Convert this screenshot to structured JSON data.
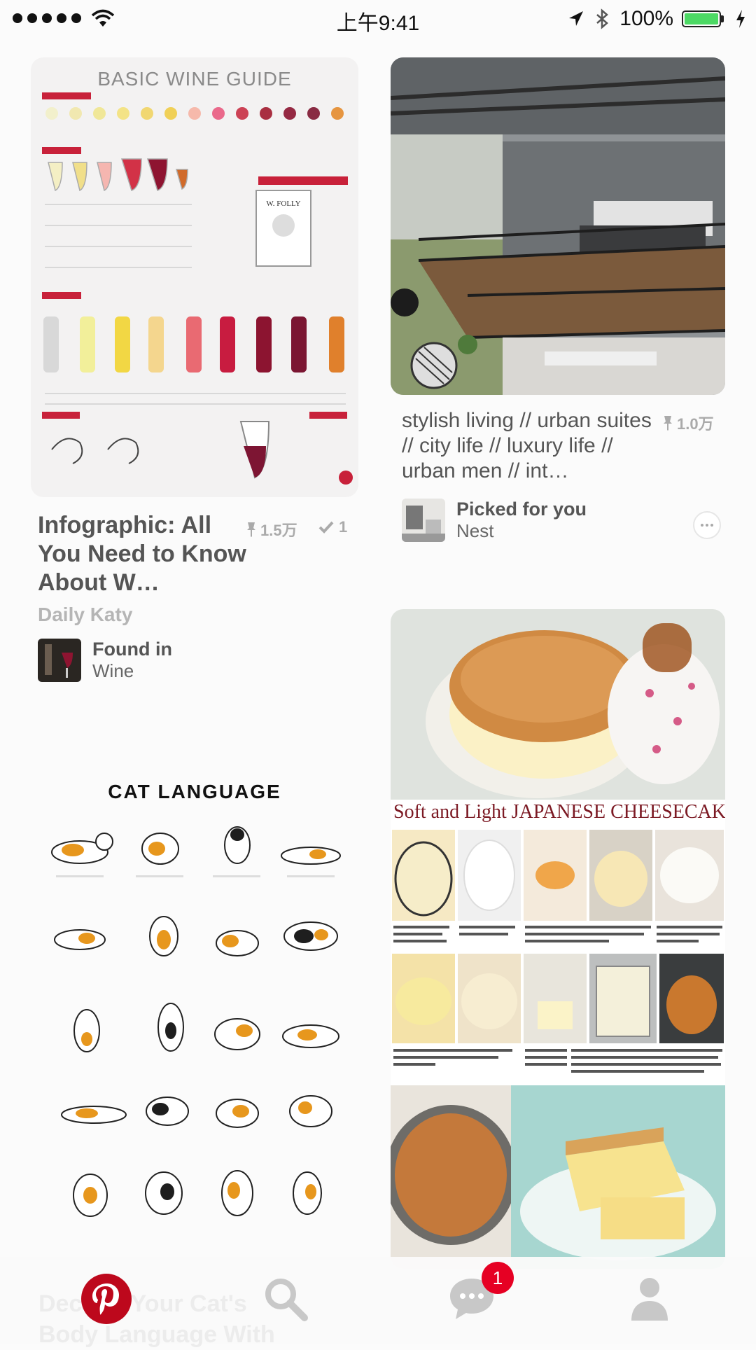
{
  "status_bar": {
    "time": "上午9:41",
    "battery_percent": "100%",
    "signal_icon": "signal-dots-icon",
    "wifi_icon": "wifi-icon",
    "location_icon": "location-arrow-icon",
    "bluetooth_icon": "bluetooth-icon",
    "battery_color": "#4cd964"
  },
  "feed": {
    "pins": [
      {
        "image_text": "BASIC WINE GUIDE",
        "title": "Infographic: All You Need to Know About W…",
        "repins": "1.5万",
        "tried": "1",
        "source": "Daily Katy",
        "board_label": "Found in",
        "board_name": "Wine"
      },
      {
        "title": "stylish living // urban suites // city life // luxury life // urban men // int…",
        "repins": "1.0万",
        "board_label": "Picked for you",
        "board_name": "Nest"
      },
      {
        "image_text": "CAT LANGUAGE",
        "ghost_title": "Decode Your Cat's Body Language With"
      },
      {
        "image_text": "Soft and Light JAPANESE CHEESECAKE"
      }
    ]
  },
  "tab_bar": {
    "home_icon": "pinterest-logo-icon",
    "search_icon": "search-icon",
    "messages_icon": "chat-bubble-icon",
    "messages_badge": "1",
    "profile_icon": "person-icon",
    "brand_color": "#bd081c"
  }
}
